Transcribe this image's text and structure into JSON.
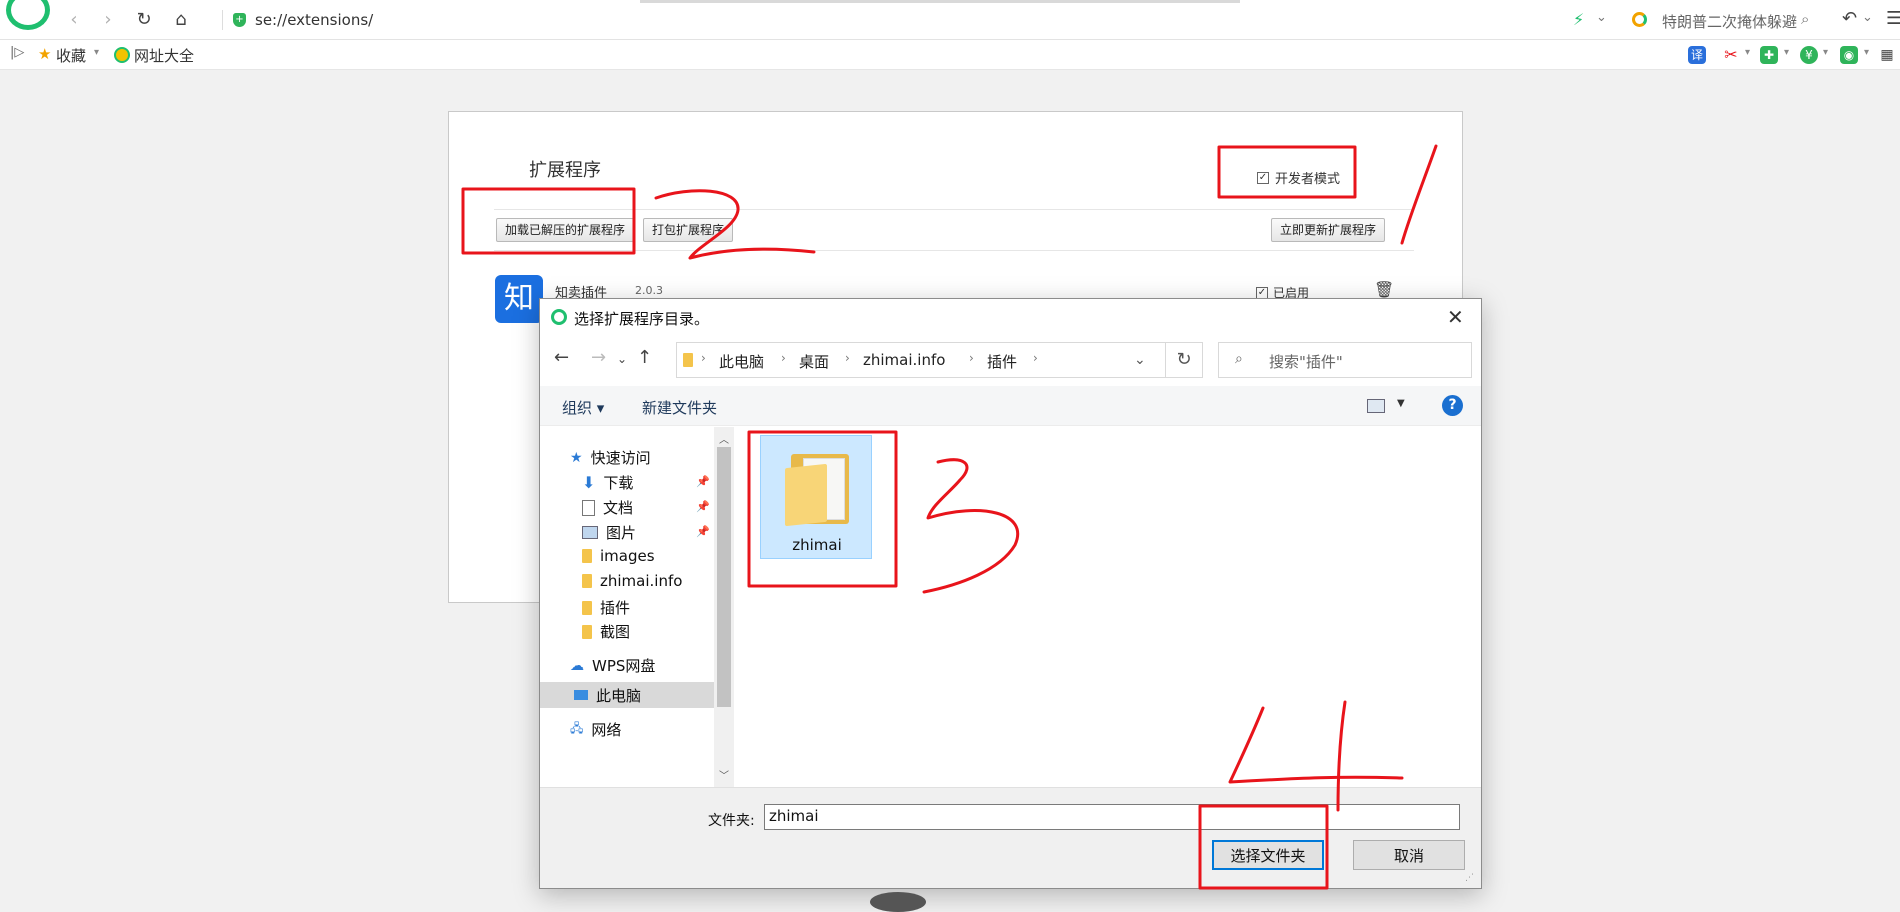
{
  "browser": {
    "address": "se://extensions/",
    "hot_search": "特朗普二次掩体躲避",
    "bookmarks": {
      "favorites": "收藏",
      "sites": "网址大全"
    }
  },
  "ext_page": {
    "title": "扩展程序",
    "dev_mode": "开发者模式",
    "load_unpacked": "加载已解压的扩展程序",
    "pack": "打包扩展程序",
    "update_now": "立即更新扩展程序",
    "extension": {
      "name": "知卖插件",
      "version": "2.0.3",
      "enabled_label": "已启用",
      "icon_char": "知"
    }
  },
  "dialog": {
    "title": "选择扩展程序目录。",
    "breadcrumb": [
      "此电脑",
      "桌面",
      "zhimai.info",
      "插件"
    ],
    "search_placeholder": "搜索\"插件\"",
    "toolbar": {
      "organize": "组织 ▾",
      "new_folder": "新建文件夹"
    },
    "nav": {
      "quick_access": "快速访问",
      "downloads": "下载",
      "documents": "文档",
      "pictures": "图片",
      "images": "images",
      "zhimai_info": "zhimai.info",
      "plugins": "插件",
      "screenshots": "截图",
      "wps": "WPS网盘",
      "this_pc": "此电脑",
      "network": "网络"
    },
    "files": [
      {
        "name": "zhimai"
      }
    ],
    "folder_label": "文件夹:",
    "folder_value": "zhimai",
    "select_button": "选择文件夹",
    "cancel_button": "取消"
  },
  "annotations": {
    "color": "#e8141b",
    "marks": [
      "1",
      "2",
      "3",
      "4"
    ]
  }
}
